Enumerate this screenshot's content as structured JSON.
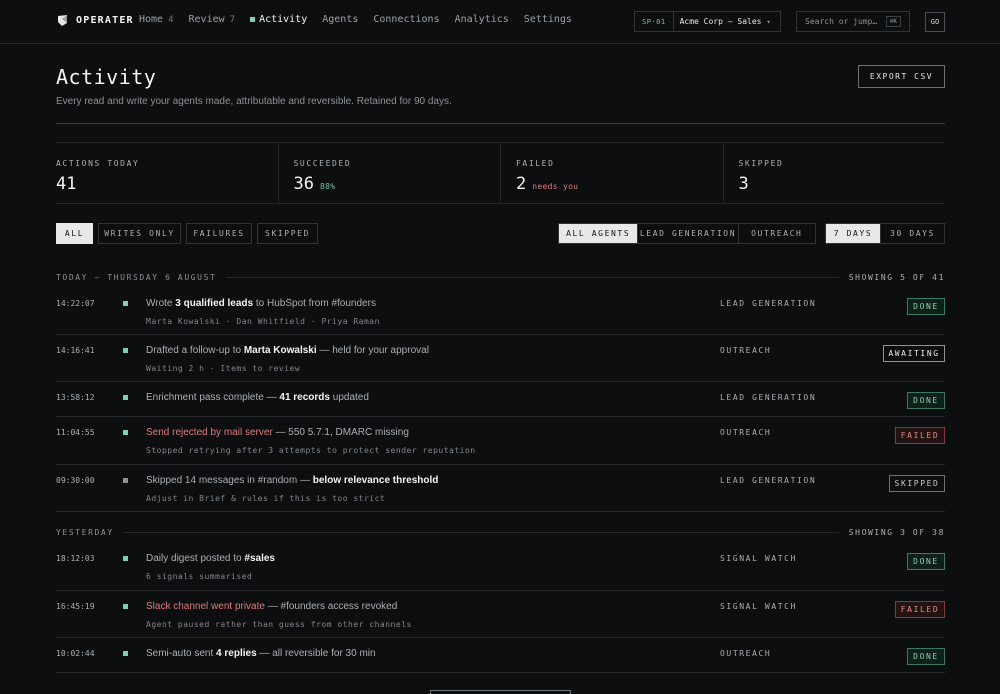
{
  "app": {
    "name": "OPERATER"
  },
  "nav": {
    "links": [
      {
        "label": "Home",
        "count": "4"
      },
      {
        "label": "Review",
        "count": "7"
      },
      {
        "label": "Activity",
        "count": ""
      },
      {
        "label": "Agents",
        "count": ""
      },
      {
        "label": "Connections",
        "count": ""
      },
      {
        "label": "Analytics",
        "count": ""
      },
      {
        "label": "Settings",
        "count": ""
      }
    ],
    "workspace_code": "SP·01",
    "workspace_name": "Acme Corp — Sales",
    "workspace_caret": "▾",
    "search_placeholder": "Search or jump…",
    "search_kbd": "⌘K",
    "avatar": "GO"
  },
  "header": {
    "title": "Activity",
    "subtitle": "Every read and write your agents made, attributable and reversible. Retained for 90 days.",
    "export_label": "EXPORT CSV"
  },
  "stats": [
    {
      "label": "ACTIONS TODAY",
      "value": "41",
      "note": ""
    },
    {
      "label": "SUCCEEDED",
      "value": "36",
      "note": "88%"
    },
    {
      "label": "FAILED",
      "value": "2",
      "note": "needs you"
    },
    {
      "label": "SKIPPED",
      "value": "3",
      "note": ""
    }
  ],
  "filters": {
    "type": [
      "ALL",
      "WRITES ONLY",
      "FAILURES",
      "SKIPPED"
    ],
    "agents": [
      "ALL AGENTS",
      "LEAD GENERATION",
      "OUTREACH"
    ],
    "range": [
      "7 DAYS",
      "30 DAYS"
    ]
  },
  "sections": [
    {
      "label": "TODAY — THURSDAY 6 AUGUST",
      "count": "SHOWING 5 OF 41",
      "rows": [
        {
          "time": "14:22:07",
          "pre": "Wrote ",
          "bold": "3 qualified leads",
          "post": " to HubSpot from #founders",
          "sub": "Marta Kowalski · Dan Whitfield · Priya Raman",
          "agent": "LEAD GENERATION",
          "status": "DONE"
        },
        {
          "time": "14:16:41",
          "pre": "Drafted a follow-up to ",
          "bold": "Marta Kowalski",
          "post": " — held for your approval",
          "sub": "Waiting 2 h · Items to review",
          "agent": "OUTREACH",
          "status": "AWAITING"
        },
        {
          "time": "13:58:12",
          "pre": "Enrichment pass complete — ",
          "bold": "41 records",
          "post": " updated",
          "sub": "",
          "agent": "LEAD GENERATION",
          "status": "DONE"
        },
        {
          "time": "11:04:55",
          "err": "Send rejected by mail server",
          "post": " — 550 5.7.1, DMARC missing",
          "sub": "Stopped retrying after 3 attempts to protect sender reputation",
          "agent": "OUTREACH",
          "status": "FAILED"
        },
        {
          "time": "09:30:00",
          "pre": "Skipped 14 messages in #random — ",
          "bold": "below relevance threshold",
          "post": "",
          "sub": "Adjust in Brief & rules if this is too strict",
          "agent": "LEAD GENERATION",
          "status": "SKIPPED"
        }
      ]
    },
    {
      "label": "YESTERDAY",
      "count": "SHOWING 3 OF 38",
      "rows": [
        {
          "time": "18:12:03",
          "pre": "Daily digest posted to ",
          "bold": "#sales",
          "post": "",
          "sub": "6 signals summarised",
          "agent": "SIGNAL WATCH",
          "status": "DONE"
        },
        {
          "time": "16:45:19",
          "err": "Slack channel went private",
          "post": " — #founders access revoked",
          "sub": "Agent paused rather than guess from other channels",
          "agent": "SIGNAL WATCH",
          "status": "FAILED"
        },
        {
          "time": "10:02:44",
          "pre": "Semi-auto sent ",
          "bold": "4 replies",
          "post": " — all reversible for 30 min",
          "sub": "",
          "agent": "OUTREACH",
          "status": "DONE"
        }
      ]
    }
  ],
  "colors": {
    "bg": "#0c0e10",
    "accent_green": "#7fd1b2",
    "error_red": "#e07a7a",
    "dot_done": "#7fd1b2",
    "dot_skipped": "#8b9298"
  }
}
